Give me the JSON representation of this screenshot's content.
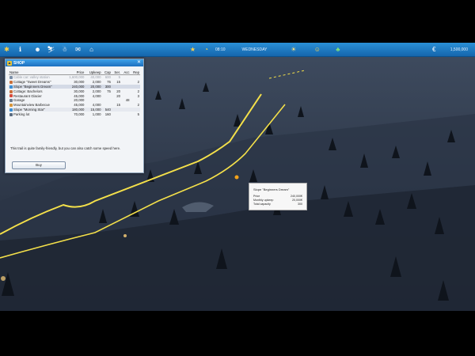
{
  "topbar": {
    "time": "08:10",
    "day": "WEDNESDAY",
    "money": "1,500,000",
    "icons": [
      "gear-icon",
      "info-icon",
      "users-icon",
      "trail-icon",
      "snowman-icon",
      "mail-icon",
      "shop-icon",
      "star-icon",
      "clock-icon",
      "weather-icon",
      "smiley-icon",
      "trees-icon",
      "money-icon"
    ]
  },
  "shop": {
    "title": "SHOP",
    "columns": [
      "Name",
      "Price",
      "Upkeep",
      "Cap",
      "Ser.",
      "Acc",
      "Rep"
    ],
    "items": [
      {
        "name": "Cable car: valley station",
        "price": "1,600,000",
        "upkeep": "40,000",
        "cap": "600",
        "ser": "5",
        "acc": "",
        "rep": "",
        "state": "disabled"
      },
      {
        "name": "Cottage \"Sweet Dreams\"",
        "price": "30,000",
        "upkeep": "2,000",
        "cap": "75",
        "ser": "15",
        "acc": "",
        "rep": "2",
        "state": ""
      },
      {
        "name": "Slope \"Beginners Dream\"",
        "price": "240,000",
        "upkeep": "20,000",
        "cap": "300",
        "ser": "",
        "acc": "",
        "rep": "",
        "state": "sel"
      },
      {
        "name": "Cottage: Bachelors",
        "price": "30,000",
        "upkeep": "2,000",
        "cap": "75",
        "ser": "20",
        "acc": "",
        "rep": "2",
        "state": ""
      },
      {
        "name": "Restaurant Glacier",
        "price": "45,000",
        "upkeep": "4,000",
        "cap": "",
        "ser": "20",
        "acc": "",
        "rep": "3",
        "state": ""
      },
      {
        "name": "Garage",
        "price": "20,000",
        "upkeep": "",
        "cap": "",
        "ser": "",
        "acc": "48",
        "rep": "",
        "state": ""
      },
      {
        "name": "Mountainview Barbecue",
        "price": "45,000",
        "upkeep": "4,000",
        "cap": "",
        "ser": "15",
        "acc": "",
        "rep": "2",
        "state": ""
      },
      {
        "name": "Slope \"Morning Star\"",
        "price": "180,000",
        "upkeep": "15,000",
        "cap": "540",
        "ser": "",
        "acc": "",
        "rep": "",
        "state": "alt"
      },
      {
        "name": "Parking lot",
        "price": "70,000",
        "upkeep": "1,000",
        "cap": "160",
        "ser": "",
        "acc": "",
        "rep": "5",
        "state": ""
      }
    ],
    "description": "This trail is quite family-friendly, but you can also catch some speed here.",
    "buy_label": "Buy"
  },
  "tooltip": {
    "title": "Slope \"Beginners Dream\"",
    "rows": [
      {
        "label": "Price",
        "value": "240,000€"
      },
      {
        "label": "Monthly upkeep",
        "value": "20,000€"
      },
      {
        "label": "Total capacity",
        "value": "300"
      }
    ]
  },
  "colors": {
    "topbar": "#1f7cc6",
    "trail": "#f4e04a",
    "panel": "#f2f4f7"
  }
}
